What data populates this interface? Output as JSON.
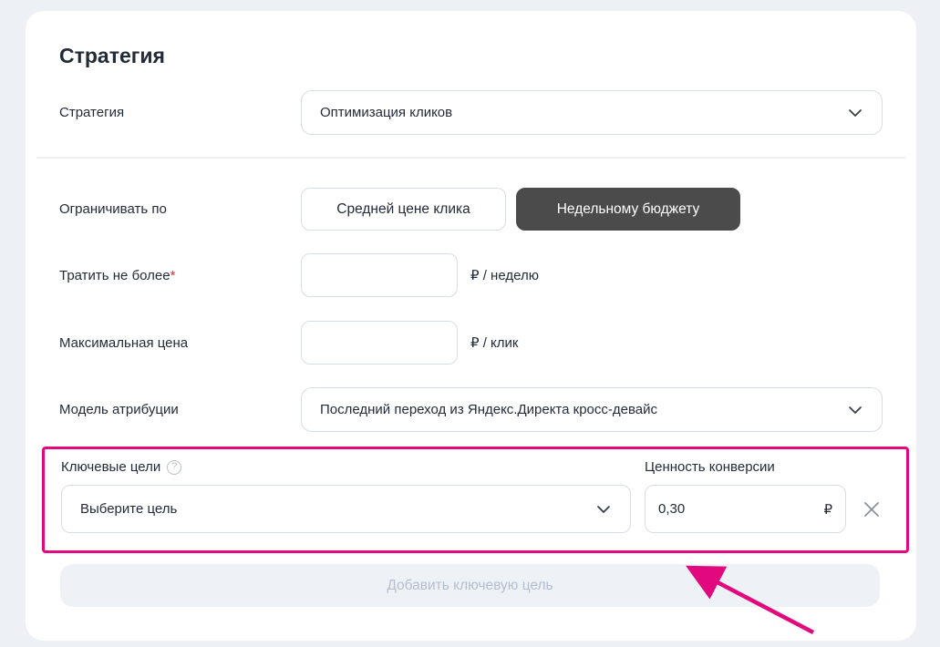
{
  "section": {
    "title": "Стратегия"
  },
  "rows": {
    "strategy": {
      "label": "Стратегия",
      "value": "Оптимизация кликов"
    },
    "limit_by": {
      "label": "Ограничивать по",
      "options": [
        {
          "label": "Средней цене клика",
          "selected": false
        },
        {
          "label": "Недельному бюджету",
          "selected": true
        }
      ]
    },
    "spend": {
      "label": "Тратить не более",
      "required_mark": "*",
      "value": "",
      "suffix": "₽ / неделю"
    },
    "max_price": {
      "label": "Максимальная цена",
      "value": "",
      "suffix": "₽ / клик"
    },
    "attribution": {
      "label": "Модель атрибуции",
      "value": "Последний переход из Яндекс.Директа кросс-девайс"
    }
  },
  "key_goals": {
    "label": "Ключевые цели",
    "help_glyph": "?",
    "value_label": "Ценность конверсии",
    "goal_placeholder": "Выберите цель",
    "conversion_value": "0,30",
    "currency": "₽"
  },
  "add_goal_button": {
    "label": "Добавить ключевую цель"
  },
  "colors": {
    "annotation_pink": "#e2097e",
    "dark_toggle": "#4b4b4b",
    "page_background": "#edf0f4",
    "required_red": "#e0342f"
  }
}
